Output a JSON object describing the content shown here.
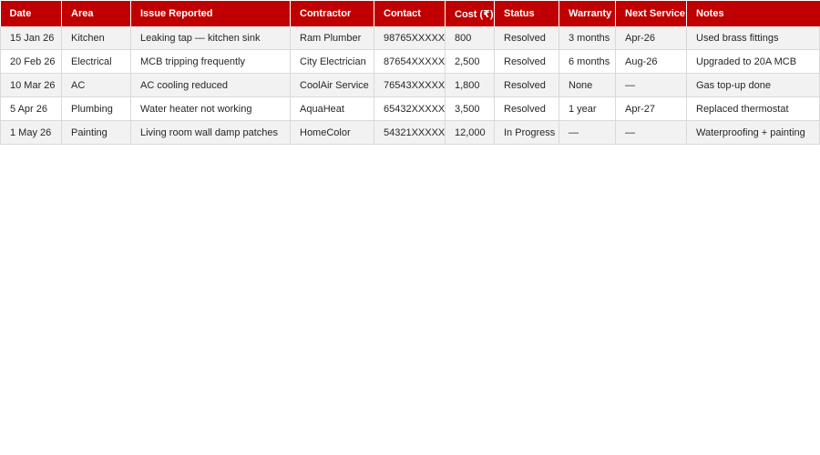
{
  "table": {
    "columns": [
      "Date",
      "Area",
      "Issue Reported",
      "Contractor",
      "Contact",
      "Cost (₹)",
      "Status",
      "Warranty",
      "Next Service",
      "Notes"
    ],
    "rows": [
      [
        "15 Jan 26",
        "Kitchen",
        "Leaking tap — kitchen sink",
        "Ram Plumber",
        "98765XXXXX",
        "800",
        "Resolved",
        "3 months",
        "Apr-26",
        "Used brass fittings"
      ],
      [
        "20 Feb 26",
        "Electrical",
        "MCB tripping frequently",
        "City Electrician",
        "87654XXXXX",
        "2,500",
        "Resolved",
        "6 months",
        "Aug-26",
        "Upgraded to 20A MCB"
      ],
      [
        "10 Mar 26",
        "AC",
        "AC cooling reduced",
        "CoolAir Service",
        "76543XXXXX",
        "1,800",
        "Resolved",
        "None",
        "—",
        "Gas top-up done"
      ],
      [
        "5 Apr 26",
        "Plumbing",
        "Water heater not working",
        "AquaHeat",
        "65432XXXXX",
        "3,500",
        "Resolved",
        "1 year",
        "Apr-27",
        "Replaced thermostat"
      ],
      [
        "1 May 26",
        "Painting",
        "Living room wall damp patches",
        "HomeColor",
        "54321XXXXX",
        "12,000",
        "In Progress",
        "—",
        "—",
        "Waterproofing + painting"
      ]
    ]
  },
  "colors": {
    "header_bg": "#c00000",
    "header_text": "#ffffff",
    "row_alt_bg": "#f2f2f2",
    "grid": "#d9d9d9"
  }
}
